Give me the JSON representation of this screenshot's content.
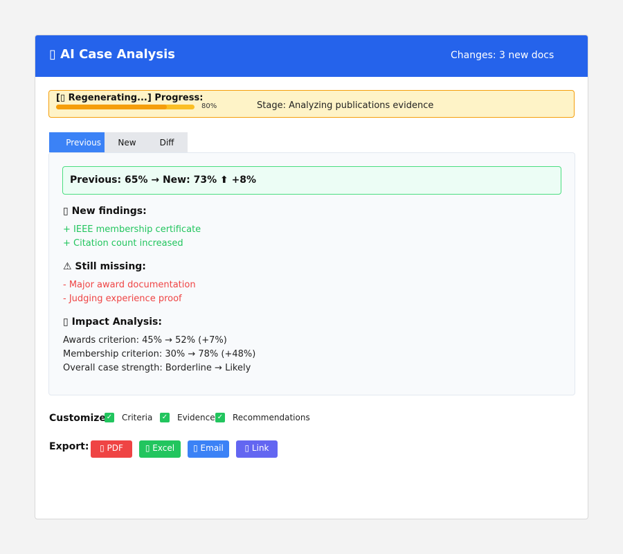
{
  "header": {
    "title": "▯ AI Case Analysis",
    "changes": "Changes: 3 new docs",
    "color": "#2563eb"
  },
  "progress": {
    "label": "[▯ Regenerating...] Progress:",
    "percent": 80,
    "percent_label": "80%",
    "stage": "Stage: Analyzing publications evidence"
  },
  "tabs": [
    {
      "label": "Previous",
      "active": true
    },
    {
      "label": "New",
      "active": false
    },
    {
      "label": "Diff",
      "active": false
    }
  ],
  "summary": "Previous: 65% → New: 73% ⬆ +8%",
  "new_findings": {
    "heading": "▯ New findings:",
    "items": [
      "+ IEEE membership certificate",
      "+ Citation count increased"
    ]
  },
  "still_missing": {
    "heading": "⚠ Still missing:",
    "items": [
      "- Major award documentation",
      "- Judging experience proof"
    ]
  },
  "impact": {
    "heading": "▯ Impact Analysis:",
    "items": [
      "Awards criterion: 45% → 52% (+7%)",
      "Membership criterion: 30% → 78% (+48%)",
      "Overall case strength: Borderline → Likely"
    ]
  },
  "customize": {
    "label": "Customize:",
    "options": [
      {
        "label": "Criteria",
        "checked": true
      },
      {
        "label": "Evidence",
        "checked": true
      },
      {
        "label": "Recommendations",
        "checked": true
      }
    ]
  },
  "export": {
    "label": "Export:",
    "buttons": [
      "▯ PDF",
      "▯ Excel",
      "▯ Email",
      "▯ Link"
    ]
  }
}
